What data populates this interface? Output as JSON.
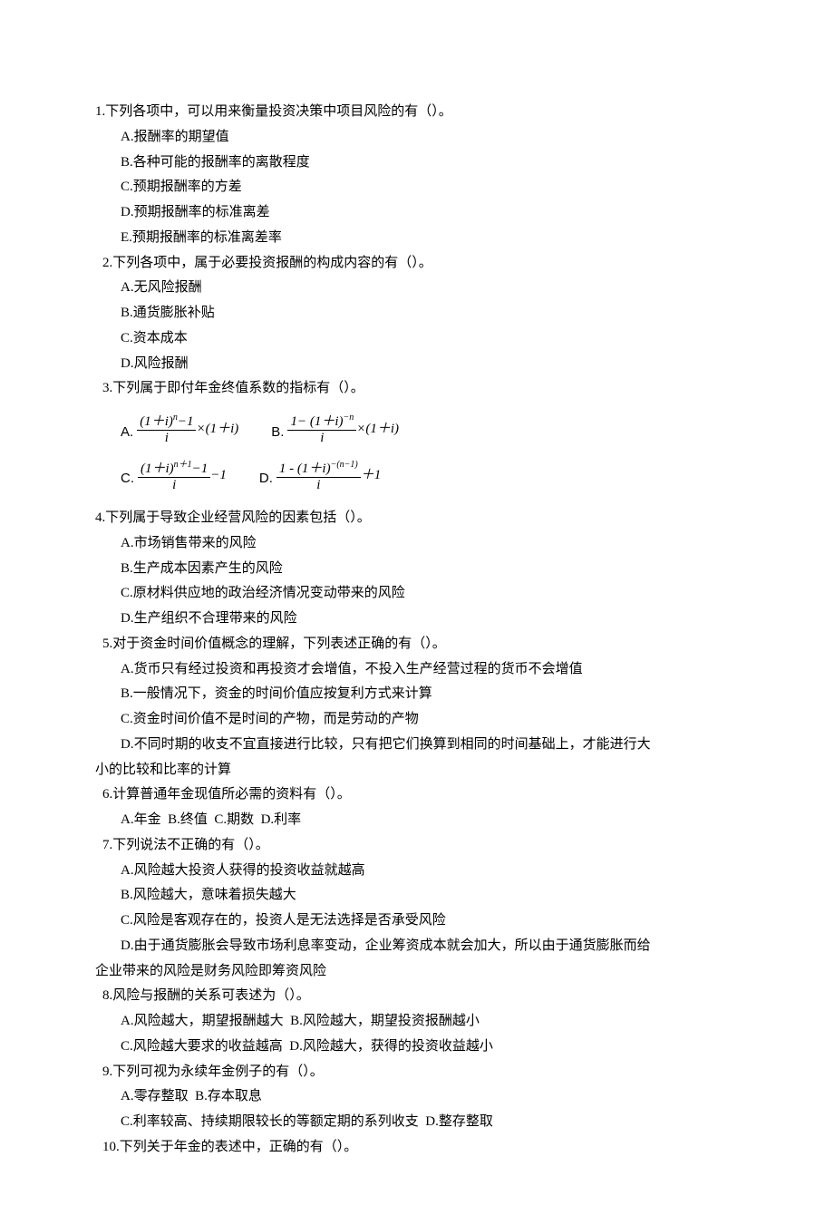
{
  "q1": {
    "stem": "1.下列各项中，可以用来衡量投资决策中项目风险的有（）。",
    "a": "A.报酬率的期望值",
    "b": "B.各种可能的报酬率的离散程度",
    "c": "C.预期报酬率的方差",
    "d": "D.预期报酬率的标准离差",
    "e": "E.预期报酬率的标准离差率"
  },
  "q2": {
    "stem": "2.下列各项中，属于必要投资报酬的构成内容的有（）。",
    "a": "A.无风险报酬",
    "b": "B.通货膨胀补贴",
    "c": "C.资本成本",
    "d": "D.风险报酬"
  },
  "q3": {
    "stem": "3.下列属于即付年金终值系数的指标有（）。",
    "la": "A.",
    "lb": "B.",
    "lc": "C.",
    "ld": "D."
  },
  "q4": {
    "stem": "4.下列属于导致企业经营风险的因素包括（）。",
    "a": "A.市场销售带来的风险",
    "b": "B.生产成本因素产生的风险",
    "c": "C.原材料供应地的政治经济情况变动带来的风险",
    "d": "D.生产组织不合理带来的风险"
  },
  "q5": {
    "stem": "5.对于资金时间价值概念的理解，下列表述正确的有（）。",
    "a": "A.货币只有经过投资和再投资才会增值，不投入生产经营过程的货币不会增值",
    "b": "B.一般情况下，资金的时间价值应按复利方式来计算",
    "c": "C.资金时间价值不是时间的产物，而是劳动的产物",
    "d": "D.不同时期的收支不宜直接进行比较，只有把它们换算到相同的时间基础上，才能进行大",
    "d2": "小的比较和比率的计算"
  },
  "q6": {
    "stem": "6.计算普通年金现值所必需的资料有（）。",
    "opts": "A.年金  B.终值  C.期数  D.利率"
  },
  "q7": {
    "stem": "7.下列说法不正确的有（）。",
    "a": "A.风险越大投资人获得的投资收益就越高",
    "b": "B.风险越大，意味着损失越大",
    "c": "C.风险是客观存在的，投资人是无法选择是否承受风险",
    "d": "D.由于通货膨胀会导致市场利息率变动，企业筹资成本就会加大，所以由于通货膨胀而给",
    "d2": "企业带来的风险是财务风险即筹资风险"
  },
  "q8": {
    "stem": "8.风险与报酬的关系可表述为（）。",
    "r1": "A.风险越大，期望报酬越大  B.风险越大，期望投资报酬越小",
    "r2": "C.风险越大要求的收益越高  D.风险越大，获得的投资收益越小"
  },
  "q9": {
    "stem": "9.下列可视为永续年金例子的有（）。",
    "r1": "A.零存整取  B.存本取息",
    "r2": "C.利率较高、持续期限较长的等额定期的系列收支  D.整存整取"
  },
  "q10": {
    "stem": "10.下列关于年金的表述中，正确的有（）。"
  }
}
